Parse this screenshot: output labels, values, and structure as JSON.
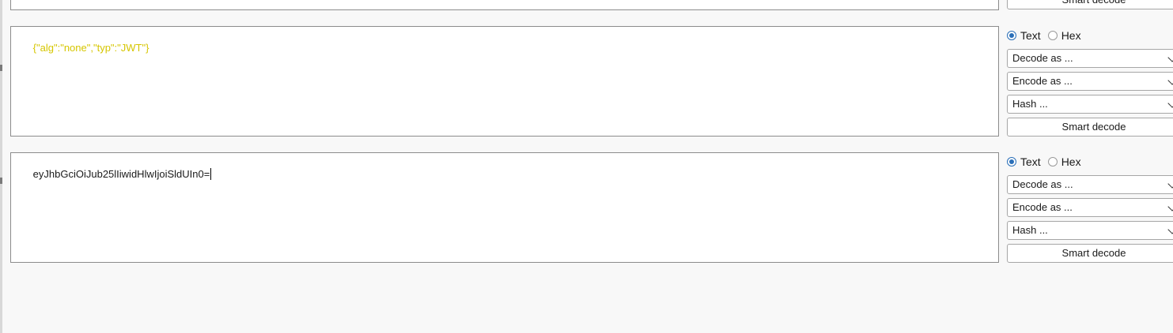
{
  "top_partial": {
    "smart_decode_label": "Smart decode"
  },
  "panels": [
    {
      "text": "{\"alg\":\"none\",\"typ\":\"JWT\"}",
      "text_color": "#d6c600",
      "mode_text_label": "Text",
      "mode_hex_label": "Hex",
      "selected_mode": "Text",
      "decode_label": "Decode as ...",
      "encode_label": "Encode as ...",
      "hash_label": "Hash ...",
      "smart_decode_label": "Smart decode"
    },
    {
      "text": "eyJhbGciOiJub25lIiwidHlwIjoiSldUIn0=",
      "text_color": "#1a1a1a",
      "mode_text_label": "Text",
      "mode_hex_label": "Hex",
      "selected_mode": "Text",
      "decode_label": "Decode as ...",
      "encode_label": "Encode as ...",
      "hash_label": "Hash ...",
      "smart_decode_label": "Smart decode"
    }
  ],
  "colors": {
    "accent": "#2a6fb8",
    "background": "#f8f8f8"
  },
  "icons": {
    "dropdown": "chevron-down-icon",
    "radio": "radio-button-icon"
  }
}
